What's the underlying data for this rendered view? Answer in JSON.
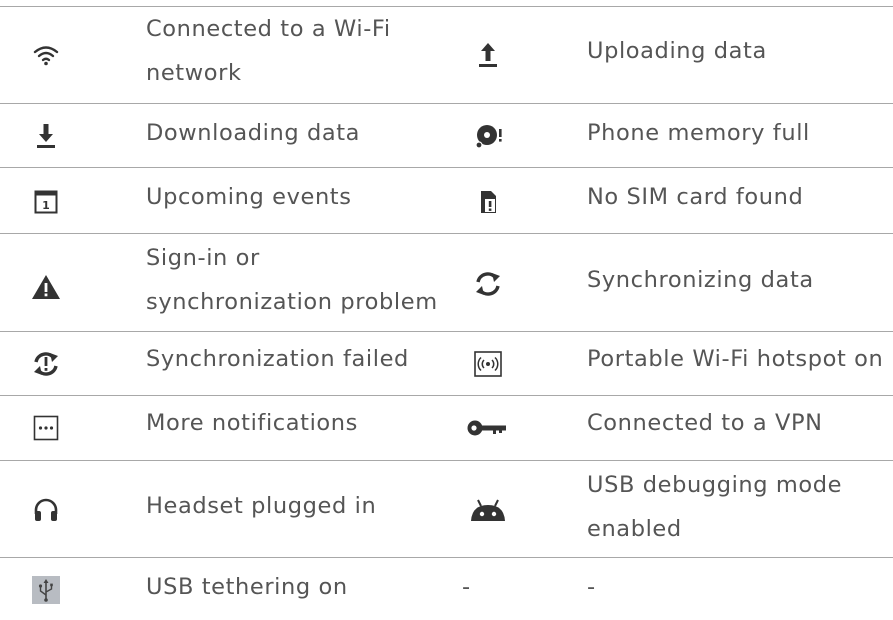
{
  "rows": [
    {
      "left": {
        "icon": "wifi-icon",
        "text": [
          "Connected to a Wi-Fi",
          "network"
        ]
      },
      "right": {
        "icon": "upload-icon",
        "text": [
          "Uploading data"
        ]
      }
    },
    {
      "left": {
        "icon": "download-icon",
        "text": [
          "Downloading data"
        ]
      },
      "right": {
        "icon": "memory-full-icon",
        "text": [
          "Phone memory full"
        ]
      }
    },
    {
      "left": {
        "icon": "calendar-icon",
        "text": [
          "Upcoming events"
        ]
      },
      "right": {
        "icon": "no-sim-icon",
        "text": [
          "No SIM card found"
        ]
      }
    },
    {
      "left": {
        "icon": "warning-icon",
        "text": [
          "Sign-in or",
          "synchronization problem"
        ]
      },
      "right": {
        "icon": "sync-icon",
        "text": [
          "Synchronizing data"
        ]
      }
    },
    {
      "left": {
        "icon": "sync-failed-icon",
        "text": [
          "Synchronization failed"
        ]
      },
      "right": {
        "icon": "hotspot-icon",
        "text": [
          "Portable Wi-Fi hotspot on"
        ]
      }
    },
    {
      "left": {
        "icon": "more-icon",
        "text": [
          "More notifications"
        ]
      },
      "right": {
        "icon": "vpn-key-icon",
        "text": [
          "Connected to a VPN"
        ]
      }
    },
    {
      "left": {
        "icon": "headset-icon",
        "text": [
          "Headset plugged in"
        ]
      },
      "right": {
        "icon": "android-icon",
        "text": [
          "USB debugging mode",
          "enabled"
        ]
      }
    },
    {
      "left": {
        "icon": "usb-icon",
        "text": [
          "USB tethering on"
        ]
      },
      "right": {
        "icon": "",
        "icon_placeholder": "-",
        "text": [
          "-"
        ]
      }
    }
  ]
}
